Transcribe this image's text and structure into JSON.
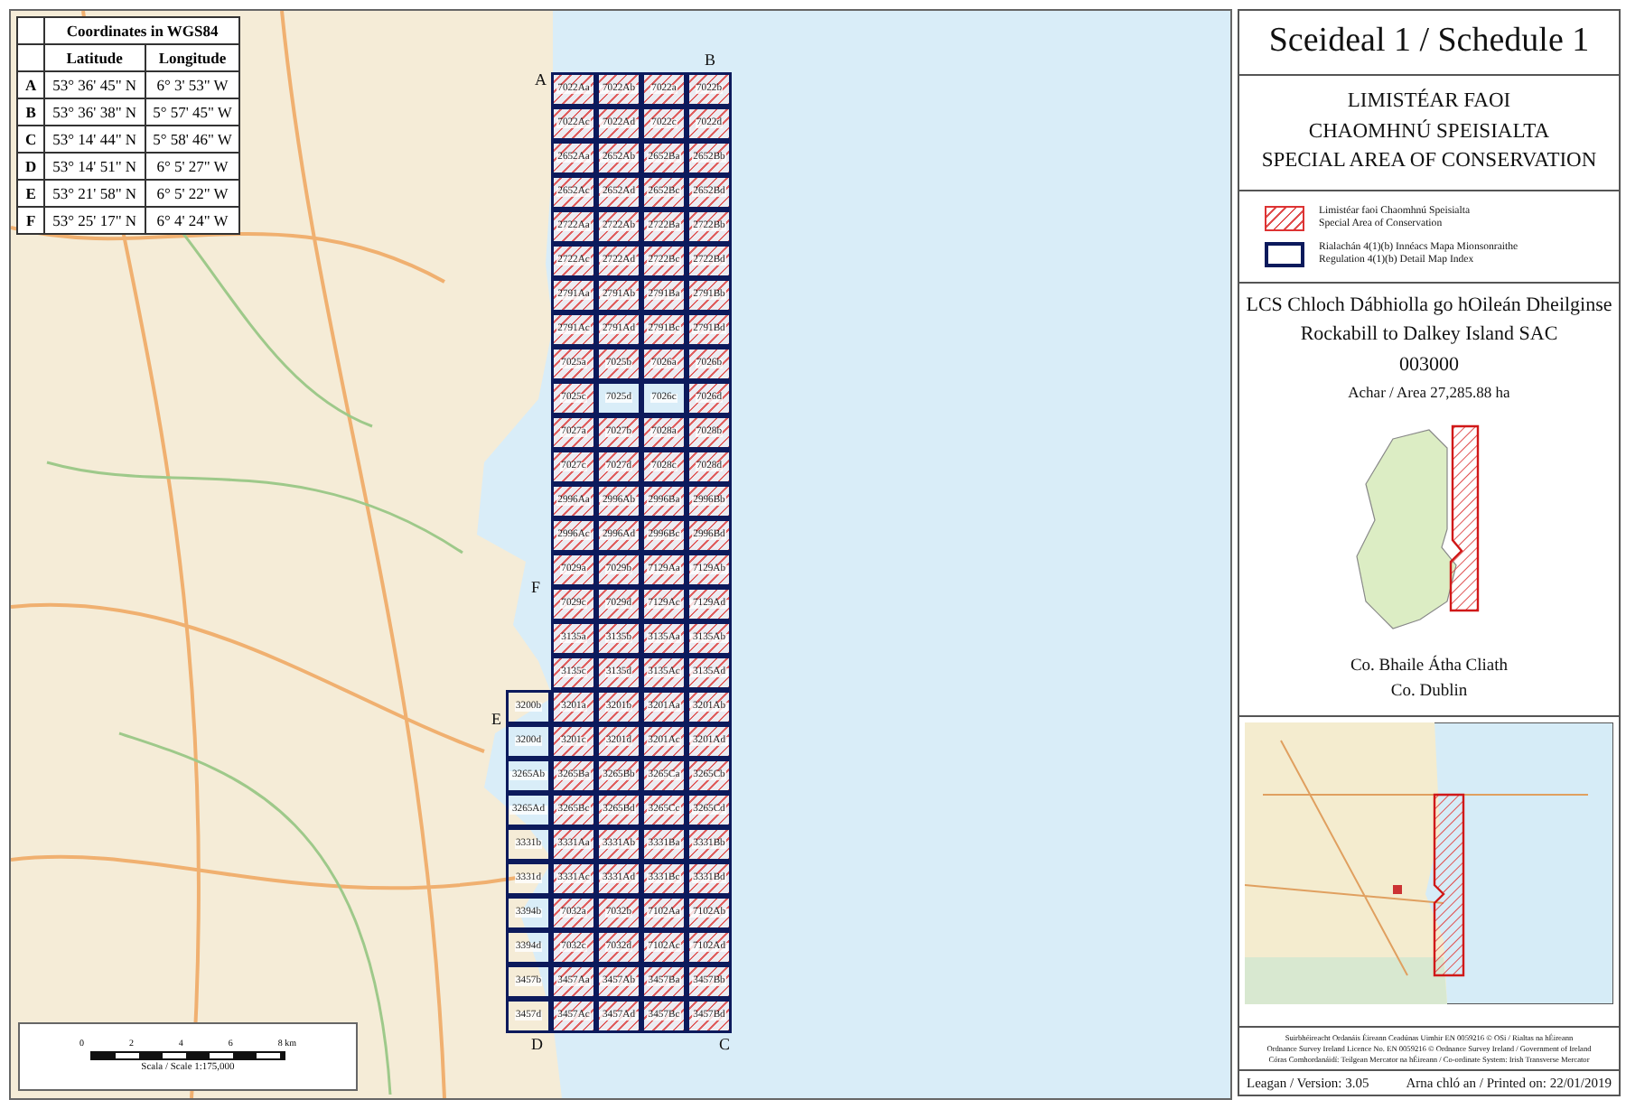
{
  "coordinates_table": {
    "title": "Coordinates in WGS84",
    "columns": [
      "Latitude",
      "Longitude"
    ],
    "rows": [
      {
        "point": "A",
        "latitude": "53° 36' 45\" N",
        "longitude": "6° 3' 53\" W"
      },
      {
        "point": "B",
        "latitude": "53° 36' 38\" N",
        "longitude": "5° 57' 45\" W"
      },
      {
        "point": "C",
        "latitude": "53° 14' 44\" N",
        "longitude": "5° 58' 46\" W"
      },
      {
        "point": "D",
        "latitude": "53° 14' 51\" N",
        "longitude": "6° 5' 27\" W"
      },
      {
        "point": "E",
        "latitude": "53° 21' 58\" N",
        "longitude": "6° 5' 22\" W"
      },
      {
        "point": "F",
        "latitude": "53° 25' 17\" N",
        "longitude": "6° 4' 24\" W"
      }
    ]
  },
  "map": {
    "corner_labels": [
      "A",
      "B",
      "C",
      "D",
      "E",
      "F"
    ],
    "grid_rows": [
      {
        "cells": [
          {
            "label": "7022Aa",
            "hatched": true
          },
          {
            "label": "7022Ab",
            "hatched": true
          },
          {
            "label": "7022a",
            "hatched": true
          },
          {
            "label": "7022b",
            "hatched": true
          }
        ]
      },
      {
        "cells": [
          {
            "label": "7022Ac",
            "hatched": true
          },
          {
            "label": "7022Ad",
            "hatched": true
          },
          {
            "label": "7022c",
            "hatched": true
          },
          {
            "label": "7022d",
            "hatched": true
          }
        ]
      },
      {
        "cells": [
          {
            "label": "2652Aa",
            "hatched": true
          },
          {
            "label": "2652Ab",
            "hatched": true
          },
          {
            "label": "2652Ba",
            "hatched": true
          },
          {
            "label": "2652Bb",
            "hatched": true
          }
        ]
      },
      {
        "cells": [
          {
            "label": "2652Ac",
            "hatched": true
          },
          {
            "label": "2652Ad",
            "hatched": true
          },
          {
            "label": "2652Bc",
            "hatched": true
          },
          {
            "label": "2652Bd",
            "hatched": true
          }
        ]
      },
      {
        "cells": [
          {
            "label": "2722Aa",
            "hatched": true
          },
          {
            "label": "2722Ab",
            "hatched": true
          },
          {
            "label": "2722Ba",
            "hatched": true
          },
          {
            "label": "2722Bb",
            "hatched": true
          }
        ]
      },
      {
        "cells": [
          {
            "label": "2722Ac",
            "hatched": true
          },
          {
            "label": "2722Ad",
            "hatched": true
          },
          {
            "label": "2722Bc",
            "hatched": true
          },
          {
            "label": "2722Bd",
            "hatched": true
          }
        ]
      },
      {
        "cells": [
          {
            "label": "2791Aa",
            "hatched": true
          },
          {
            "label": "2791Ab",
            "hatched": true
          },
          {
            "label": "2791Ba",
            "hatched": true
          },
          {
            "label": "2791Bb",
            "hatched": true
          }
        ]
      },
      {
        "cells": [
          {
            "label": "2791Ac",
            "hatched": true
          },
          {
            "label": "2791Ad",
            "hatched": true
          },
          {
            "label": "2791Bc",
            "hatched": true
          },
          {
            "label": "2791Bd",
            "hatched": true
          }
        ]
      },
      {
        "cells": [
          {
            "label": "7025a",
            "hatched": true
          },
          {
            "label": "7025b",
            "hatched": true
          },
          {
            "label": "7026a",
            "hatched": true
          },
          {
            "label": "7026b",
            "hatched": true
          }
        ]
      },
      {
        "cells": [
          {
            "label": "7025c",
            "hatched": true
          },
          {
            "label": "7025d",
            "hatched": false
          },
          {
            "label": "7026c",
            "hatched": false
          },
          {
            "label": "7026d",
            "hatched": true
          }
        ]
      },
      {
        "cells": [
          {
            "label": "7027a",
            "hatched": true
          },
          {
            "label": "7027b",
            "hatched": true
          },
          {
            "label": "7028a",
            "hatched": true
          },
          {
            "label": "7028b",
            "hatched": true
          }
        ]
      },
      {
        "cells": [
          {
            "label": "7027c",
            "hatched": true
          },
          {
            "label": "7027d",
            "hatched": true
          },
          {
            "label": "7028c",
            "hatched": true
          },
          {
            "label": "7028d",
            "hatched": true
          }
        ]
      },
      {
        "cells": [
          {
            "label": "2996Aa",
            "hatched": true
          },
          {
            "label": "2996Ab",
            "hatched": true
          },
          {
            "label": "2996Ba",
            "hatched": true
          },
          {
            "label": "2996Bb",
            "hatched": true
          }
        ]
      },
      {
        "cells": [
          {
            "label": "2996Ac",
            "hatched": true
          },
          {
            "label": "2996Ad",
            "hatched": true
          },
          {
            "label": "2996Bc",
            "hatched": true
          },
          {
            "label": "2996Bd",
            "hatched": true
          }
        ]
      },
      {
        "cells": [
          {
            "label": "7029a",
            "hatched": true
          },
          {
            "label": "7029b",
            "hatched": true
          },
          {
            "label": "7129Aa",
            "hatched": true
          },
          {
            "label": "7129Ab",
            "hatched": true
          }
        ]
      },
      {
        "cells": [
          {
            "label": "7029c",
            "hatched": true
          },
          {
            "label": "7029d",
            "hatched": true
          },
          {
            "label": "7129Ac",
            "hatched": true
          },
          {
            "label": "7129Ad",
            "hatched": true
          }
        ]
      },
      {
        "cells": [
          {
            "label": "3135a",
            "hatched": true
          },
          {
            "label": "3135b",
            "hatched": true
          },
          {
            "label": "3135Aa",
            "hatched": true
          },
          {
            "label": "3135Ab",
            "hatched": true
          }
        ]
      },
      {
        "cells": [
          {
            "label": "3135c",
            "hatched": true
          },
          {
            "label": "3135d",
            "hatched": true
          },
          {
            "label": "3135Ac",
            "hatched": true
          },
          {
            "label": "3135Ad",
            "hatched": true
          }
        ]
      },
      {
        "cells": [
          {
            "label": "3200b",
            "hatched": false
          },
          {
            "label": "3201a",
            "hatched": true
          },
          {
            "label": "3201b",
            "hatched": true
          },
          {
            "label": "3201Aa",
            "hatched": true
          },
          {
            "label": "3201Ab",
            "hatched": true
          }
        ]
      },
      {
        "cells": [
          {
            "label": "3200d",
            "hatched": false
          },
          {
            "label": "3201c",
            "hatched": true
          },
          {
            "label": "3201d",
            "hatched": true
          },
          {
            "label": "3201Ac",
            "hatched": true
          },
          {
            "label": "3201Ad",
            "hatched": true
          }
        ]
      },
      {
        "cells": [
          {
            "label": "3265Ab",
            "hatched": false
          },
          {
            "label": "3265Ba",
            "hatched": true
          },
          {
            "label": "3265Bb",
            "hatched": true
          },
          {
            "label": "3265Ca",
            "hatched": true
          },
          {
            "label": "3265Cb",
            "hatched": true
          }
        ]
      },
      {
        "cells": [
          {
            "label": "3265Ad",
            "hatched": false
          },
          {
            "label": "3265Bc",
            "hatched": true
          },
          {
            "label": "3265Bd",
            "hatched": true
          },
          {
            "label": "3265Cc",
            "hatched": true
          },
          {
            "label": "3265Cd",
            "hatched": true
          }
        ]
      },
      {
        "cells": [
          {
            "label": "3331b",
            "hatched": false
          },
          {
            "label": "3331Aa",
            "hatched": true
          },
          {
            "label": "3331Ab",
            "hatched": true
          },
          {
            "label": "3331Ba",
            "hatched": true
          },
          {
            "label": "3331Bb",
            "hatched": true
          }
        ]
      },
      {
        "cells": [
          {
            "label": "3331d",
            "hatched": false
          },
          {
            "label": "3331Ac",
            "hatched": true
          },
          {
            "label": "3331Ad",
            "hatched": true
          },
          {
            "label": "3331Bc",
            "hatched": true
          },
          {
            "label": "3331Bd",
            "hatched": true
          }
        ]
      },
      {
        "cells": [
          {
            "label": "3394b",
            "hatched": false
          },
          {
            "label": "7032a",
            "hatched": true
          },
          {
            "label": "7032b",
            "hatched": true
          },
          {
            "label": "7102Aa",
            "hatched": true
          },
          {
            "label": "7102Ab",
            "hatched": true
          }
        ]
      },
      {
        "cells": [
          {
            "label": "3394d",
            "hatched": false
          },
          {
            "label": "7032c",
            "hatched": true
          },
          {
            "label": "7032d",
            "hatched": true
          },
          {
            "label": "7102Ac",
            "hatched": true
          },
          {
            "label": "7102Ad",
            "hatched": true
          }
        ]
      },
      {
        "cells": [
          {
            "label": "3457b",
            "hatched": false
          },
          {
            "label": "3457Aa",
            "hatched": true
          },
          {
            "label": "3457Ab",
            "hatched": true
          },
          {
            "label": "3457Ba",
            "hatched": true
          },
          {
            "label": "3457Bb",
            "hatched": true
          }
        ]
      },
      {
        "cells": [
          {
            "label": "3457d",
            "hatched": false
          },
          {
            "label": "3457Ac",
            "hatched": true
          },
          {
            "label": "3457Ad",
            "hatched": true
          },
          {
            "label": "3457Bc",
            "hatched": true
          },
          {
            "label": "3457Bd",
            "hatched": true
          }
        ]
      }
    ]
  },
  "scale_bar": {
    "ticks": [
      "0",
      "2",
      "4",
      "6",
      "8 km"
    ],
    "label": "Scala / Scale 1:175,000"
  },
  "panel": {
    "title": "Sceideal 1 / Schedule 1",
    "heading_lines": [
      "LIMISTÉAR FAOI",
      "CHAOMHNÚ SPEISIALTA",
      "SPECIAL AREA OF CONSERVATION"
    ],
    "legend": [
      {
        "kind": "hatched",
        "lines": [
          "Limistéar faoi Chaomhnú Speisialta",
          "Special Area of Conservation"
        ]
      },
      {
        "kind": "outline",
        "lines": [
          "Rialachán 4(1)(b) Innéacs Mapa Mionsonraithe",
          "Regulation 4(1)(b) Detail Map Index"
        ]
      }
    ],
    "site_name_irish": "LCS Chloch Dábhiolla go hOileán Dheilginse",
    "site_name": "Rockabill to Dalkey Island SAC",
    "site_code": "003000",
    "area": "Achar / Area 27,285.88 ha",
    "county_lines": [
      "Co. Bhaile Átha Cliath",
      "Co. Dublin"
    ],
    "credits": [
      "Suirbhéireacht Ordanáis Éireann Ceadúnas Uimhir EN 0059216 © OSi / Rialtas na hÉireann",
      "Ordnance Survey Ireland Licence No. EN 0059216 © Ordnance Survey Ireland / Government of Ireland",
      "Córas Comhordanáidí: Teilgean Mercator na hÉireann / Co-ordinate System: Irish Transverse Mercator"
    ],
    "version": "Leagan / Version: 3.05",
    "printed": "Arna chló an / Printed on: 22/01/2019"
  }
}
